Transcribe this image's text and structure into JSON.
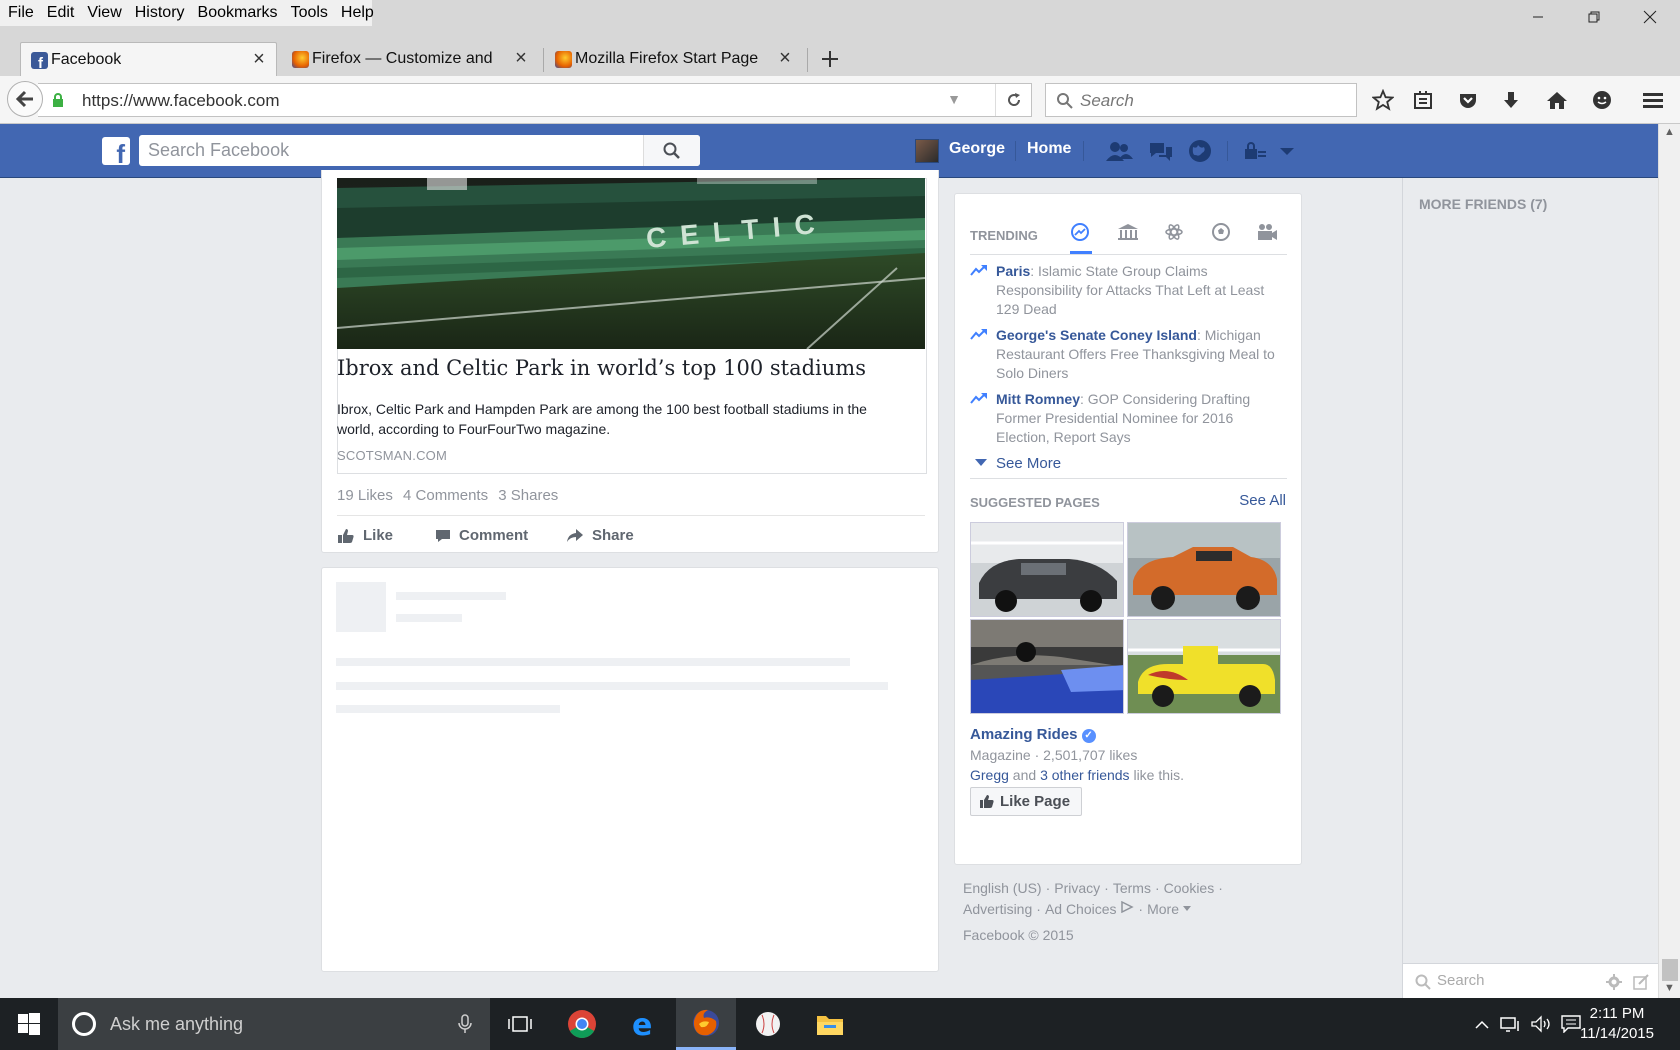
{
  "browser": {
    "menu": [
      "File",
      "Edit",
      "View",
      "History",
      "Bookmarks",
      "Tools",
      "Help"
    ],
    "tabs": [
      {
        "title": "Facebook",
        "active": true
      },
      {
        "title": "Firefox — Customize and ...",
        "active": false
      },
      {
        "title": "Mozilla Firefox Start Page",
        "active": false
      }
    ],
    "url": "https://www.facebook.com",
    "search_placeholder": "Search"
  },
  "facebook": {
    "search_placeholder": "Search Facebook",
    "user_name": "George",
    "home_label": "Home",
    "post": {
      "link_title": "Ibrox and Celtic Park in world’s top 100 stadiums",
      "link_desc": "Ibrox, Celtic Park and Hampden Park are among the 100 best football stadiums in the world, according to FourFourTwo magazine.",
      "link_domain": "SCOTSMAN.COM",
      "stadium_text": "CELTIC",
      "likes": "19 Likes",
      "comments": "4 Comments",
      "shares": "3 Shares",
      "actions": {
        "like": "Like",
        "comment": "Comment",
        "share": "Share"
      }
    },
    "trending": {
      "heading": "TRENDING",
      "items": [
        {
          "topic": "Paris",
          "text": ": Islamic State Group Claims Responsibility for Attacks That Left at Least 129 Dead"
        },
        {
          "topic": "George's Senate Coney Island",
          "text": ": Michigan Restaurant Offers Free Thanksgiving Meal to Solo Diners"
        },
        {
          "topic": "Mitt Romney",
          "text": ": GOP Considering Drafting Former Presidential Nominee for 2016 Election, Report Says"
        }
      ],
      "see_more": "See More"
    },
    "suggested": {
      "heading": "SUGGESTED PAGES",
      "see_all": "See All",
      "page_name": "Amazing Rides",
      "meta": "Magazine · 2,501,707 likes",
      "friend1": "Gregg",
      "and": " and ",
      "friend2": "3 other friends",
      "like_this": " like this.",
      "like_button": "Like Page"
    },
    "footer": {
      "links1": [
        "English (US)",
        "Privacy",
        "Terms",
        "Cookies"
      ],
      "links2": [
        "Advertising",
        "Ad Choices",
        "More"
      ],
      "copyright": "Facebook © 2015"
    },
    "chat": {
      "more_friends": "MORE FRIENDS (7)",
      "search_placeholder": "Search"
    }
  },
  "taskbar": {
    "cortana_placeholder": "Ask me anything",
    "time": "2:11 PM",
    "date": "11/14/2015"
  },
  "colors": {
    "facebook_blue": "#4267b2",
    "link_blue": "#365899",
    "taskbar": "#1d2124"
  }
}
